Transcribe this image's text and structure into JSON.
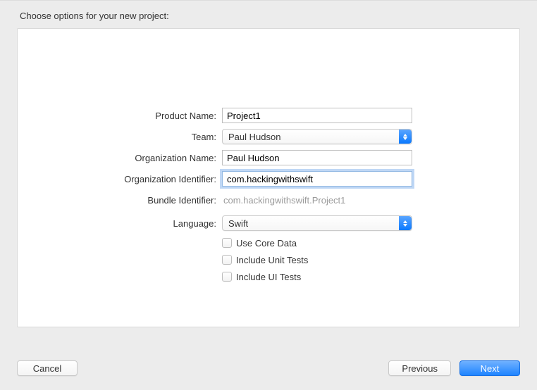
{
  "sheet": {
    "title": "Choose options for your new project:"
  },
  "form": {
    "productName": {
      "label": "Product Name:",
      "value": "Project1"
    },
    "team": {
      "label": "Team:",
      "selected": "Paul Hudson"
    },
    "orgName": {
      "label": "Organization Name:",
      "value": "Paul Hudson"
    },
    "orgIdentifier": {
      "label": "Organization Identifier:",
      "value": "com.hackingwithswift"
    },
    "bundleIdentifier": {
      "label": "Bundle Identifier:",
      "value": "com.hackingwithswift.Project1"
    },
    "language": {
      "label": "Language:",
      "selected": "Swift"
    },
    "useCoreData": {
      "label": "Use Core Data",
      "checked": false
    },
    "includeUnitTests": {
      "label": "Include Unit Tests",
      "checked": false
    },
    "includeUITests": {
      "label": "Include UI Tests",
      "checked": false
    }
  },
  "buttons": {
    "cancel": "Cancel",
    "previous": "Previous",
    "next": "Next"
  }
}
